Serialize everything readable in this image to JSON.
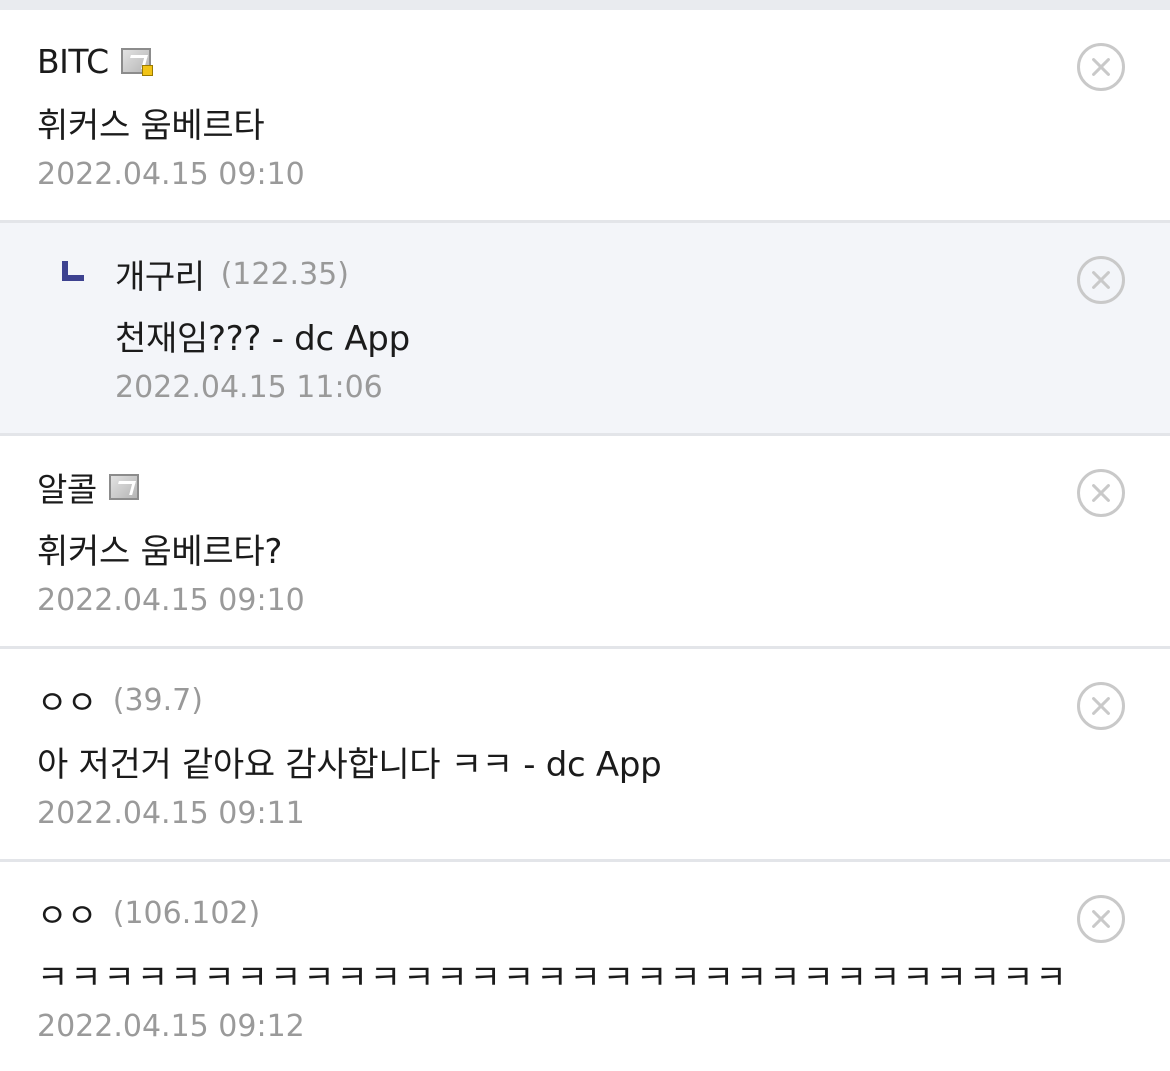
{
  "comments": [
    {
      "nickname": "BITC",
      "ip": "",
      "badge": "gallog-icon-fixed",
      "text": "휘커스 움베르타",
      "time": "2022.04.15 09:10",
      "is_reply": false
    },
    {
      "nickname": "개구리",
      "ip": "(122.35)",
      "badge": "",
      "text": "천재임??? - dc App",
      "time": "2022.04.15 11:06",
      "is_reply": true
    },
    {
      "nickname": "알콜",
      "ip": "",
      "badge": "gallog-icon",
      "text": "휘커스 움베르타?",
      "time": "2022.04.15 09:10",
      "is_reply": false
    },
    {
      "nickname": "ㅇㅇ",
      "ip": "(39.7)",
      "badge": "",
      "text": "아 저건거 같아요 감사합니다 ㅋㅋ - dc App",
      "time": "2022.04.15 09:11",
      "is_reply": false
    },
    {
      "nickname": "ㅇㅇ",
      "ip": "(106.102)",
      "badge": "",
      "text": "ㅋㅋㅋㅋㅋㅋㅋㅋㅋㅋㅋㅋㅋㅋㅋㅋㅋㅋㅋㅋㅋㅋㅋㅋㅋㅋㅋㅋㅋㅋㅋ",
      "time": "2022.04.15 09:12",
      "is_reply": false
    }
  ],
  "icons": {
    "delete": "delete-circle-x-icon",
    "reply_marker": "reply-arrow-icon"
  },
  "colors": {
    "reply_background": "#f3f5f9",
    "reply_marker": "#3d4290",
    "meta_text": "#9a9a9a"
  }
}
